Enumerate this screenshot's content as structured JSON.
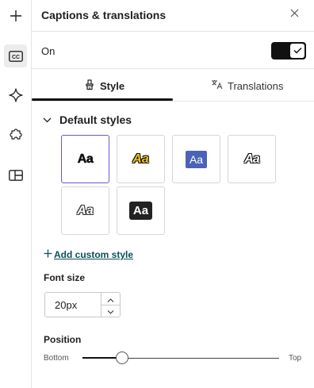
{
  "rail": {
    "items": [
      {
        "icon": "plus-icon",
        "active": false
      },
      {
        "icon": "closed-captions-icon",
        "active": true
      },
      {
        "icon": "sparkle-icon",
        "active": false
      },
      {
        "icon": "puzzle-icon",
        "active": false
      },
      {
        "icon": "layout-icon",
        "active": false
      }
    ]
  },
  "header": {
    "title": "Captions & translations",
    "close_icon": "close-icon"
  },
  "toggle_row": {
    "label": "On",
    "checked": true
  },
  "tabs": [
    {
      "label": "Style",
      "icon": "style-brush-icon",
      "active": true
    },
    {
      "label": "Translations",
      "icon": "translate-icon",
      "active": false
    }
  ],
  "default_styles": {
    "title": "Default styles",
    "expanded": true,
    "sample_text": "Aa",
    "selected_index": 0
  },
  "add_custom_style": {
    "label": "Add custom style"
  },
  "font_size": {
    "label": "Font size",
    "value": "20px"
  },
  "position": {
    "label": "Position",
    "min_label": "Bottom",
    "max_label": "Top",
    "value_fraction": 0.2
  },
  "colors": {
    "accent": "#6b57d6",
    "link": "#0d4f57",
    "blue_style": "#4a63b8",
    "yellow_style": "#f2c417"
  }
}
